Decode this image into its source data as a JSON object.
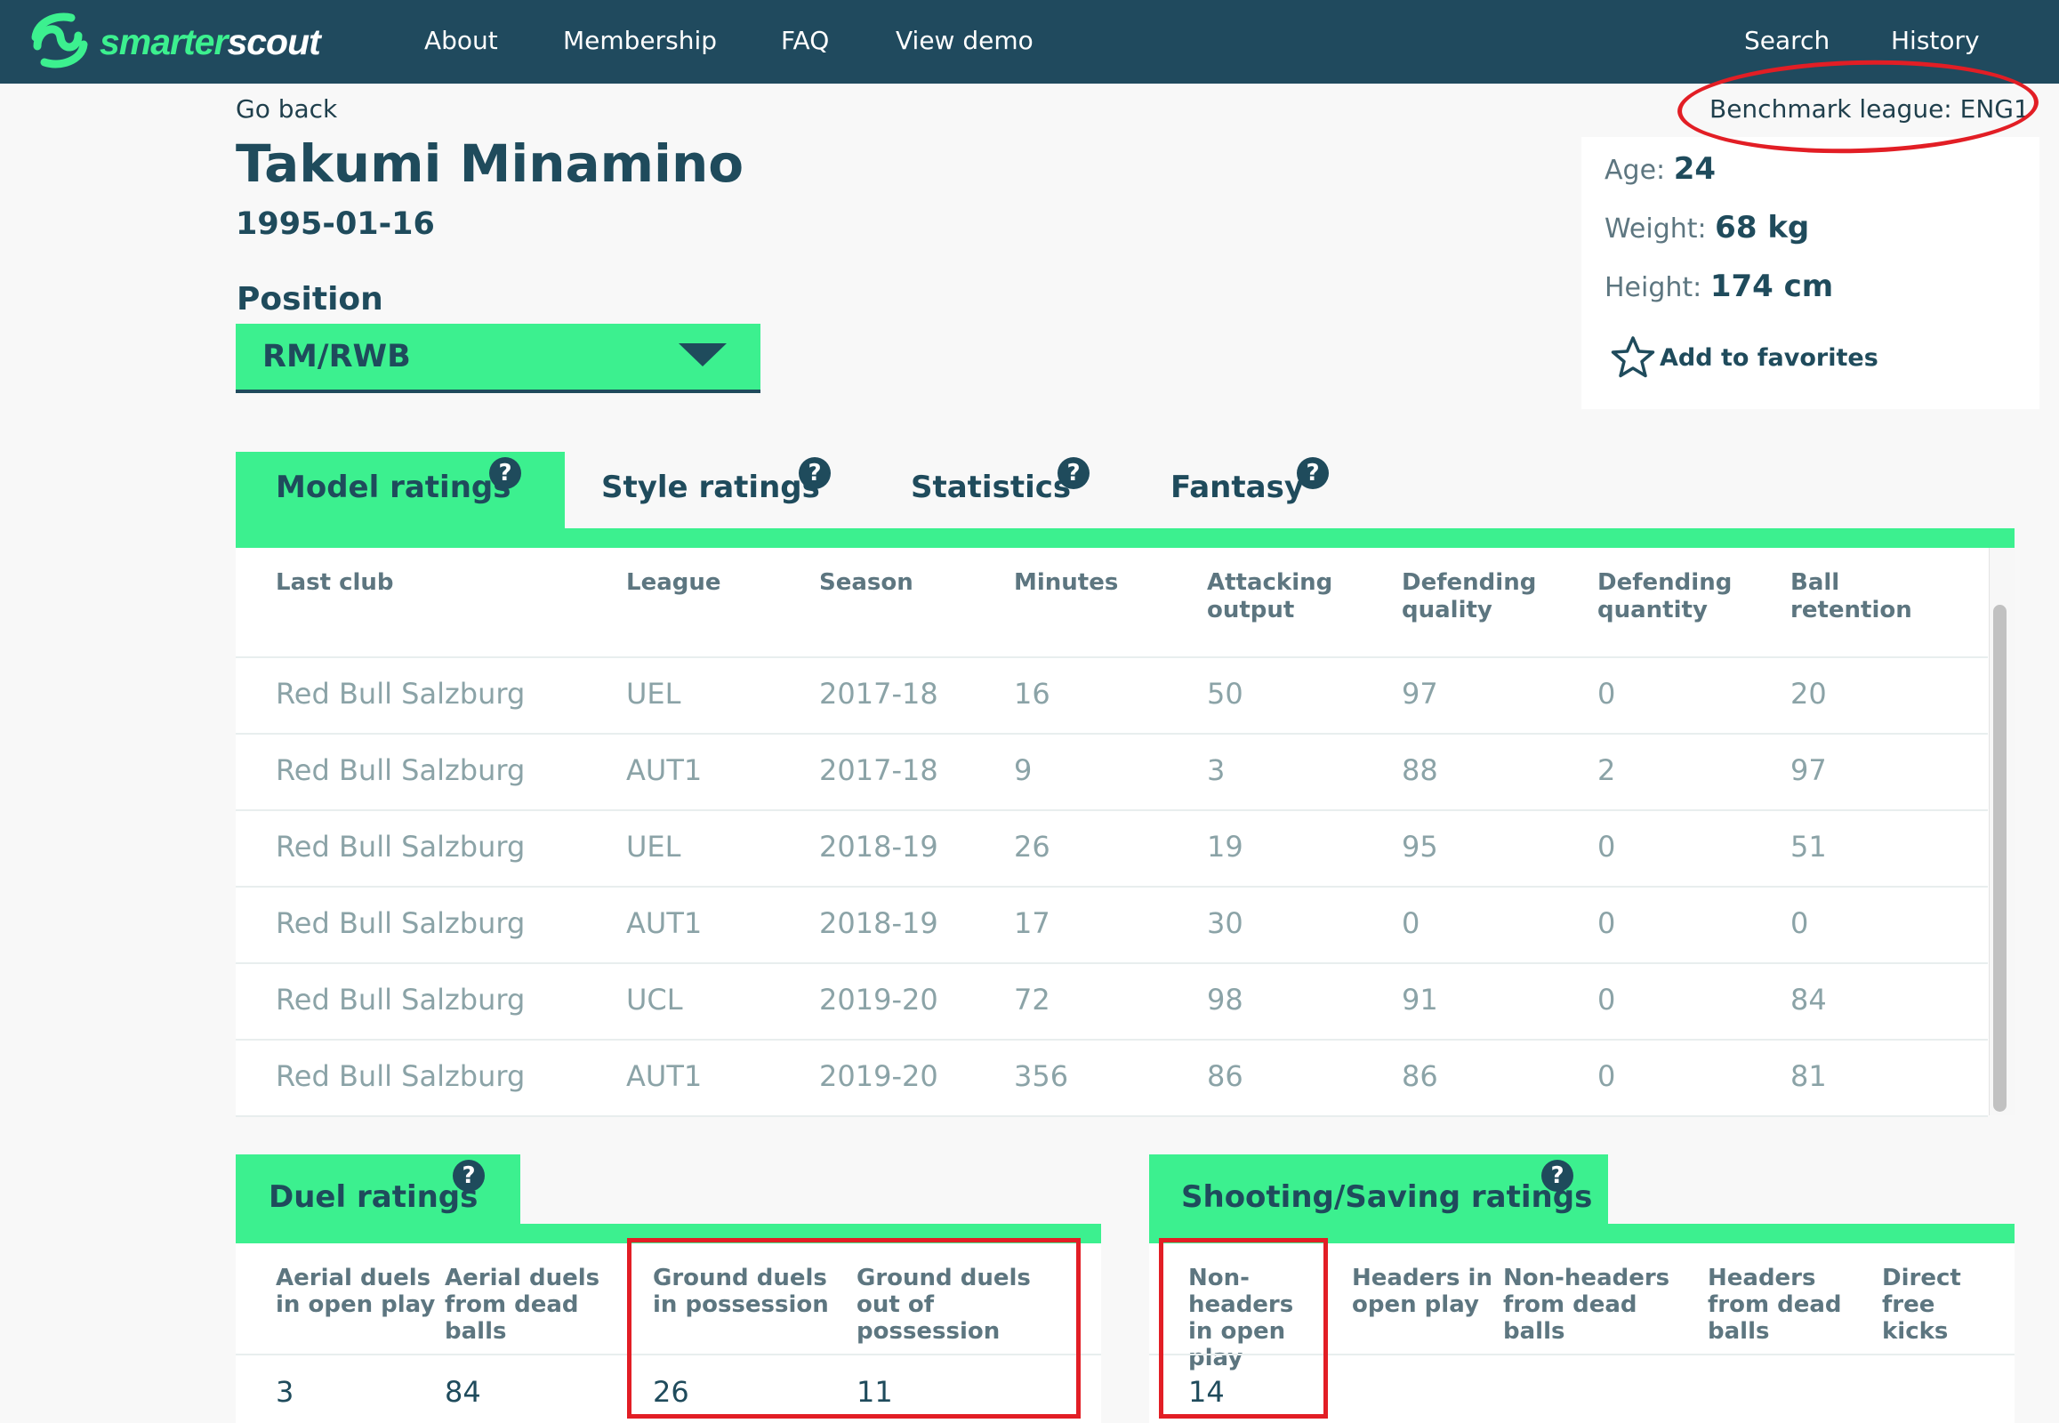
{
  "nav": {
    "logo_part1": "smarter",
    "logo_part2": "scout",
    "links": [
      "About",
      "Membership",
      "FAQ",
      "View demo"
    ],
    "right_links": [
      "Search",
      "History"
    ]
  },
  "header": {
    "go_back": "Go back",
    "player_name": "Takumi Minamino",
    "dob": "1995-01-16",
    "position_label": "Position",
    "position_value": "RM/RWB",
    "benchmark": "Benchmark league: ENG1"
  },
  "info": {
    "age_label": "Age:",
    "age_value": "24",
    "weight_label": "Weight:",
    "weight_value": "68 kg",
    "height_label": "Height:",
    "height_value": "174 cm",
    "favorite": "Add to favorites"
  },
  "tabs": [
    "Model ratings",
    "Style ratings",
    "Statistics",
    "Fantasy"
  ],
  "help_glyph": "?",
  "table": {
    "headers": [
      "Last club",
      "League",
      "Season",
      "Minutes",
      "Attacking output",
      "Defending quality",
      "Defending quantity",
      "Ball retention"
    ],
    "rows": [
      [
        "Red Bull Salzburg",
        "UEL",
        "2017-18",
        "16",
        "50",
        "97",
        "0",
        "20"
      ],
      [
        "Red Bull Salzburg",
        "AUT1",
        "2017-18",
        "9",
        "3",
        "88",
        "2",
        "97"
      ],
      [
        "Red Bull Salzburg",
        "UEL",
        "2018-19",
        "26",
        "19",
        "95",
        "0",
        "51"
      ],
      [
        "Red Bull Salzburg",
        "AUT1",
        "2018-19",
        "17",
        "30",
        "0",
        "0",
        "0"
      ],
      [
        "Red Bull Salzburg",
        "UCL",
        "2019-20",
        "72",
        "98",
        "91",
        "0",
        "84"
      ],
      [
        "Red Bull Salzburg",
        "AUT1",
        "2019-20",
        "356",
        "86",
        "86",
        "0",
        "81"
      ]
    ]
  },
  "duel": {
    "title": "Duel ratings",
    "headers": [
      "Aerial duels in open play",
      "Aerial duels from dead balls",
      "Ground duels in possession",
      "Ground duels out of possession"
    ],
    "values": [
      "3",
      "84",
      "26",
      "11"
    ]
  },
  "shooting": {
    "title": "Shooting/Saving ratings",
    "headers": [
      "Non-headers in open play",
      "Headers in open play",
      "Non-headers from dead balls",
      "Headers from dead balls",
      "Direct free kicks"
    ],
    "values": [
      "14",
      "",
      "",
      "",
      ""
    ]
  },
  "colors": {
    "nav_bg": "#204a5e",
    "accent_green": "#3cf08f",
    "text_dark": "#1f4b5c",
    "muted_text": "#8ba3a7",
    "annotation_red": "#e21e25"
  }
}
